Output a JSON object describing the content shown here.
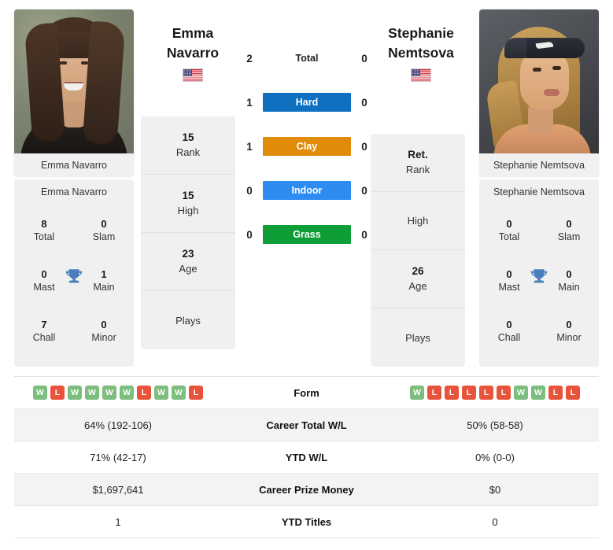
{
  "players": {
    "left": {
      "name_lines": [
        "Emma",
        "Navarro"
      ],
      "full_name": "Emma Navarro",
      "photo_caption": "Emma Navarro",
      "country_flag": "us-flag-icon",
      "rank": {
        "rank_value": "15",
        "rank_label": "Rank",
        "high_value": "15",
        "high_label": "High",
        "age_value": "23",
        "age_label": "Age",
        "plays_value": "",
        "plays_label": "Plays"
      },
      "titles": {
        "total_value": "8",
        "total_label": "Total",
        "slam_value": "0",
        "slam_label": "Slam",
        "mast_value": "0",
        "mast_label": "Mast",
        "main_value": "1",
        "main_label": "Main",
        "chall_value": "7",
        "chall_label": "Chall",
        "minor_value": "0",
        "minor_label": "Minor"
      },
      "form": [
        "W",
        "L",
        "W",
        "W",
        "W",
        "W",
        "L",
        "W",
        "W",
        "L"
      ],
      "career_total_wl": "64% (192-106)",
      "ytd_wl": "71% (42-17)",
      "career_prize_money": "$1,697,641",
      "ytd_titles": "1"
    },
    "right": {
      "name_lines": [
        "Stephanie",
        "Nemtsova"
      ],
      "full_name": "Stephanie Nemtsova",
      "photo_caption": "Stephanie Nemtsova",
      "country_flag": "us-flag-icon",
      "rank": {
        "rank_value": "Ret.",
        "rank_label": "Rank",
        "high_value": "",
        "high_label": "High",
        "age_value": "26",
        "age_label": "Age",
        "plays_value": "",
        "plays_label": "Plays"
      },
      "titles": {
        "total_value": "0",
        "total_label": "Total",
        "slam_value": "0",
        "slam_label": "Slam",
        "mast_value": "0",
        "mast_label": "Mast",
        "main_value": "0",
        "main_label": "Main",
        "chall_value": "0",
        "chall_label": "Chall",
        "minor_value": "0",
        "minor_label": "Minor"
      },
      "form": [
        "W",
        "L",
        "L",
        "L",
        "L",
        "L",
        "W",
        "W",
        "L",
        "L"
      ],
      "career_total_wl": "50% (58-58)",
      "ytd_wl": "0% (0-0)",
      "career_prize_money": "$0",
      "ytd_titles": "0"
    }
  },
  "head_to_head": [
    {
      "left": "2",
      "label": "Total",
      "color": "",
      "style": "plain"
    },
    {
      "left": "1",
      "label": "Hard",
      "color": "#0f6fc0",
      "style": "chip",
      "right": "0"
    },
    {
      "left": "1",
      "label": "Clay",
      "color": "#e08c0a",
      "style": "chip",
      "right": "0"
    },
    {
      "left": "0",
      "label": "Indoor",
      "color": "#2e8cf0",
      "style": "chip",
      "right": "0"
    },
    {
      "left": "0",
      "label": "Grass",
      "color": "#0f9d38",
      "style": "chip",
      "right": "0"
    }
  ],
  "h2h_values": {
    "total_left": "2",
    "total_right": "0",
    "hard_left": "1",
    "hard_right": "0",
    "clay_left": "1",
    "clay_right": "0",
    "indoor_left": "0",
    "indoor_right": "0",
    "grass_left": "0",
    "grass_right": "0"
  },
  "h2h_labels": {
    "total": "Total",
    "hard": "Hard",
    "clay": "Clay",
    "indoor": "Indoor",
    "grass": "Grass"
  },
  "stats_rows": {
    "form": "Form",
    "career_total_wl": "Career Total W/L",
    "ytd_wl": "YTD W/L",
    "career_prize_money": "Career Prize Money",
    "ytd_titles": "YTD Titles"
  },
  "colors": {
    "hard": "#0f6fc0",
    "clay": "#e08c0a",
    "indoor": "#2e8cf0",
    "grass": "#0f9d38",
    "win": "#7dbd7d",
    "loss": "#e8533c",
    "trophy": "#4a7ebb",
    "card_bg": "#f0f0f0",
    "row_alt": "#f3f3f3"
  }
}
